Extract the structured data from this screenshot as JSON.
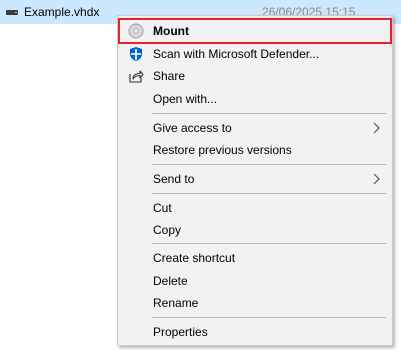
{
  "file": {
    "name": "Example.vhdx",
    "date": "26/06/2025 15:15",
    "icon": "drive-icon"
  },
  "menu": {
    "mount": {
      "label": "Mount",
      "icon": "disc-icon"
    },
    "defender": {
      "label": "Scan with Microsoft Defender...",
      "icon": "defender-shield-icon"
    },
    "share": {
      "label": "Share",
      "icon": "share-icon"
    },
    "open_with": {
      "label": "Open with..."
    },
    "give_access": {
      "label": "Give access to",
      "submenu": true
    },
    "restore": {
      "label": "Restore previous versions"
    },
    "send_to": {
      "label": "Send to",
      "submenu": true
    },
    "cut": {
      "label": "Cut"
    },
    "copy": {
      "label": "Copy"
    },
    "create_shortcut": {
      "label": "Create shortcut"
    },
    "delete": {
      "label": "Delete"
    },
    "rename": {
      "label": "Rename"
    },
    "properties": {
      "label": "Properties"
    }
  },
  "colors": {
    "selection_bg": "#cce8ff",
    "menu_bg": "#f2f2f2",
    "highlight_border": "#e8202e",
    "defender_blue": "#0067c0"
  }
}
